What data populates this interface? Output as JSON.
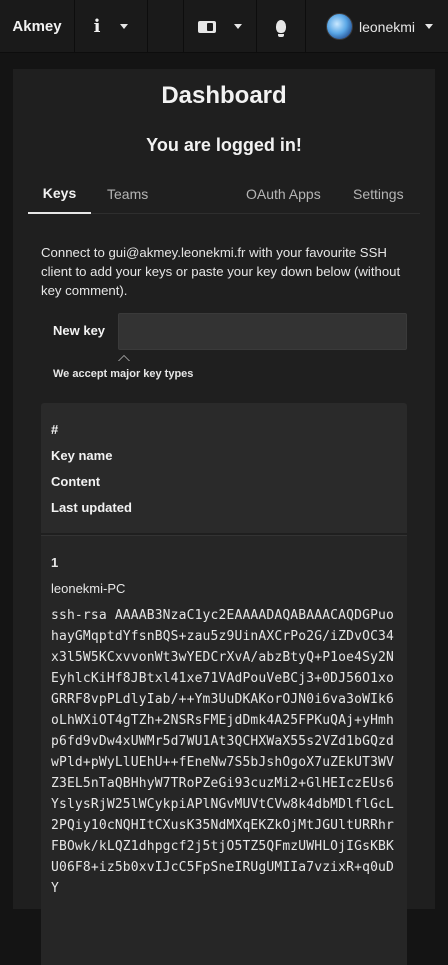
{
  "navbar": {
    "brand": "Akmey",
    "user": {
      "name": "leonekmi"
    }
  },
  "icons": {
    "info": "info-icon",
    "language": "translate-icon",
    "theme": "lightbulb-icon",
    "dropdown": "caret-down-icon"
  },
  "page": {
    "title": "Dashboard",
    "status": "You are logged in!"
  },
  "tabs": [
    {
      "label": "Keys",
      "active": true
    },
    {
      "label": "Teams",
      "active": false
    },
    {
      "label": "OAuth Apps",
      "active": false
    },
    {
      "label": "Settings",
      "active": false
    }
  ],
  "intro": "Connect to gui@akmey.leonekmi.fr with your favourite SSH client to add your keys or paste your key down below (without key comment).",
  "new_key": {
    "label": "New key",
    "value": "",
    "placeholder": "",
    "hint": "We accept major key types"
  },
  "keys_table": {
    "headers": [
      "#",
      "Key name",
      "Content",
      "Last updated"
    ],
    "rows": [
      {
        "index": "1",
        "name": "leonekmi-PC",
        "content": "ssh-rsa AAAAB3NzaC1yc2EAAAADAQABAAACAQDGPuohayGMqptdYfsnBQS+zau5z9UinAXCrPo2G/iZDvOC34x3l5W5KCxvvonWt3wYEDCrXvA/abzBtyQ+P1oe4Sy2NEyhlcKiHf8JBtxl41xe71VAdPouVeBCj3+0DJ56O1xoGRRF8vpPLdlyIab/++Ym3UuDKAKorOJN0i6va3oWIk6oLhWXiOT4gTZh+2NSRsFMEjdDmk4A25FPKuQAj+yHmhp6fd9vDw4xUWMr5d7WU1At3QCHXWaX55s2VZd1bGQzdwPld+pWyLlUEhU++fEneNw7S5bJshOgoX7uZEkUT3WVZ3EL5nTaQBHhyW7TRoPZeGi93cuzMi2+GlHEIczEUs6YslysRjW25lWCykpiAPlNGvMUVtCVw8k4dbMDlflGcL2PQiy10cNQHItCXusK35NdMXqEKZkOjMtJGUltURRhrFBOwk/kLQZ1dhpgcf2j5tjO5TZ5QFmzUWHLOjIGsKBKU06F8+iz5b0xvIJcC5FpSneIRUgUMIIa7vzixR+q0uDY"
      }
    ]
  },
  "colors": {
    "background": "#141414",
    "navbar": "#1a1a1a",
    "card": "#1f1f1f",
    "table_head": "#2a2a2a",
    "input": "#333333",
    "text": "#e6e6e6"
  }
}
